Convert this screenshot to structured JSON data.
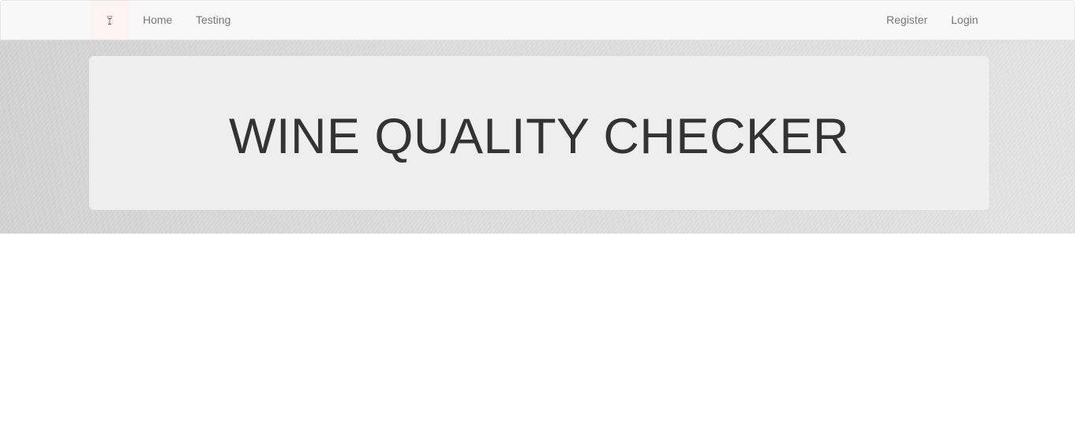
{
  "navbar": {
    "brand_icon": "wine-glass-icon",
    "left_links": [
      "Home",
      "Testing"
    ],
    "right_links": [
      "Register",
      "Login"
    ]
  },
  "hero": {
    "title": "WINE QUALITY CHECKER"
  },
  "colors": {
    "navbar_bg": "#f8f8f8",
    "link": "#777777",
    "jumbotron_bg": "#eeeeee",
    "title": "#333333",
    "brand_accent": "#8b1a2b"
  }
}
